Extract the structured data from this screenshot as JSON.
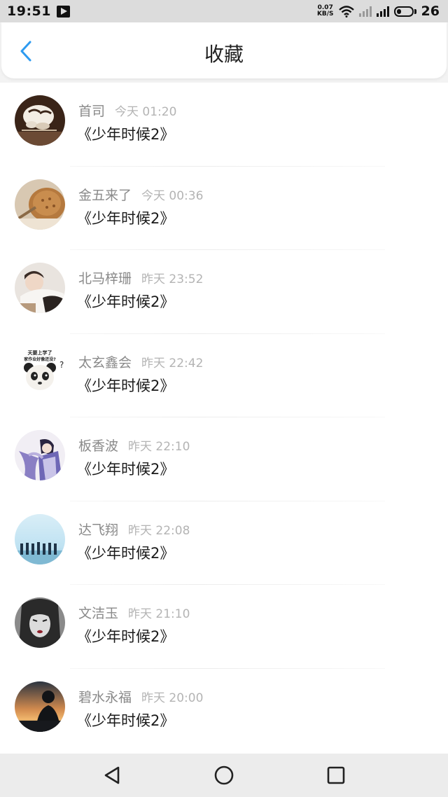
{
  "status_bar": {
    "time": "19:51",
    "net_speed_value": "0.07",
    "net_speed_unit": "KB/S",
    "battery": "26"
  },
  "header": {
    "title": "收藏"
  },
  "favorites": [
    {
      "username": "首司",
      "time": "今天 01:20",
      "title": "《少年时候2》"
    },
    {
      "username": "金五来了",
      "time": "今天 00:36",
      "title": "《少年时候2》"
    },
    {
      "username": "北马梓珊",
      "time": "昨天 23:52",
      "title": "《少年时候2》"
    },
    {
      "username": "太玄鑫会",
      "time": "昨天 22:42",
      "title": "《少年时候2》"
    },
    {
      "username": "板香波",
      "time": "昨天 22:10",
      "title": "《少年时候2》"
    },
    {
      "username": "达飞翔",
      "time": "昨天 22:08",
      "title": "《少年时候2》"
    },
    {
      "username": "文洁玉",
      "time": "昨天 21:10",
      "title": "《少年时候2》"
    },
    {
      "username": "碧水永福",
      "time": "昨天 20:00",
      "title": "《少年时候2》"
    }
  ],
  "avatar_text": {
    "meme_top": "天要上学了",
    "meme_bottom": "家作业好像还没?"
  },
  "colors": {
    "accent": "#2e9bf0",
    "username": "#8a8a8a",
    "timestamp": "#b4b4b4"
  }
}
